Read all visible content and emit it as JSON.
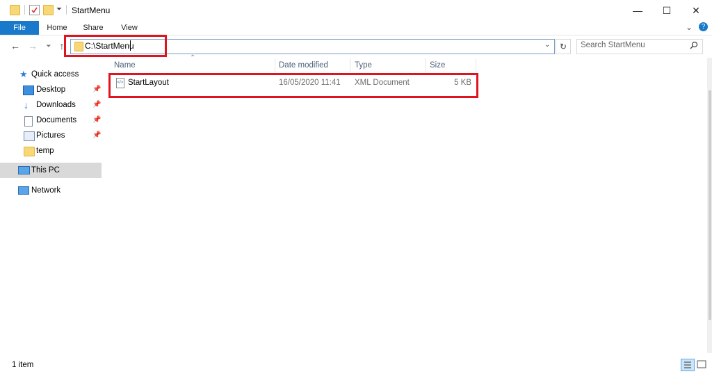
{
  "window": {
    "title": "StartMenu",
    "minimize_glyph": "—",
    "maximize_glyph": "☐",
    "close_glyph": "✕"
  },
  "ribbon": {
    "tabs": [
      "File",
      "Home",
      "Share",
      "View"
    ],
    "expand_glyph": "⌄",
    "help_glyph": "?"
  },
  "address": {
    "path": "C:\\StartMenu",
    "search_placeholder": "Search StartMenu"
  },
  "nav": {
    "quick_access": "Quick access",
    "items": [
      {
        "label": "Desktop",
        "icon": "desktop-icon",
        "pinned": true
      },
      {
        "label": "Downloads",
        "icon": "download-icon",
        "pinned": true
      },
      {
        "label": "Documents",
        "icon": "documents-icon",
        "pinned": true
      },
      {
        "label": "Pictures",
        "icon": "pictures-icon",
        "pinned": true
      },
      {
        "label": "temp",
        "icon": "folder-icon",
        "pinned": false
      }
    ],
    "this_pc": "This PC",
    "network": "Network"
  },
  "columns": [
    "Name",
    "Date modified",
    "Type",
    "Size"
  ],
  "files": [
    {
      "name": "StartLayout",
      "date": "16/05/2020 11:41",
      "type": "XML Document",
      "size": "5 KB"
    }
  ],
  "status": {
    "count": "1 item"
  },
  "colors": {
    "accent": "#1979ca",
    "highlight": "#e0141e",
    "selected_nav": "#d9d9d9"
  }
}
